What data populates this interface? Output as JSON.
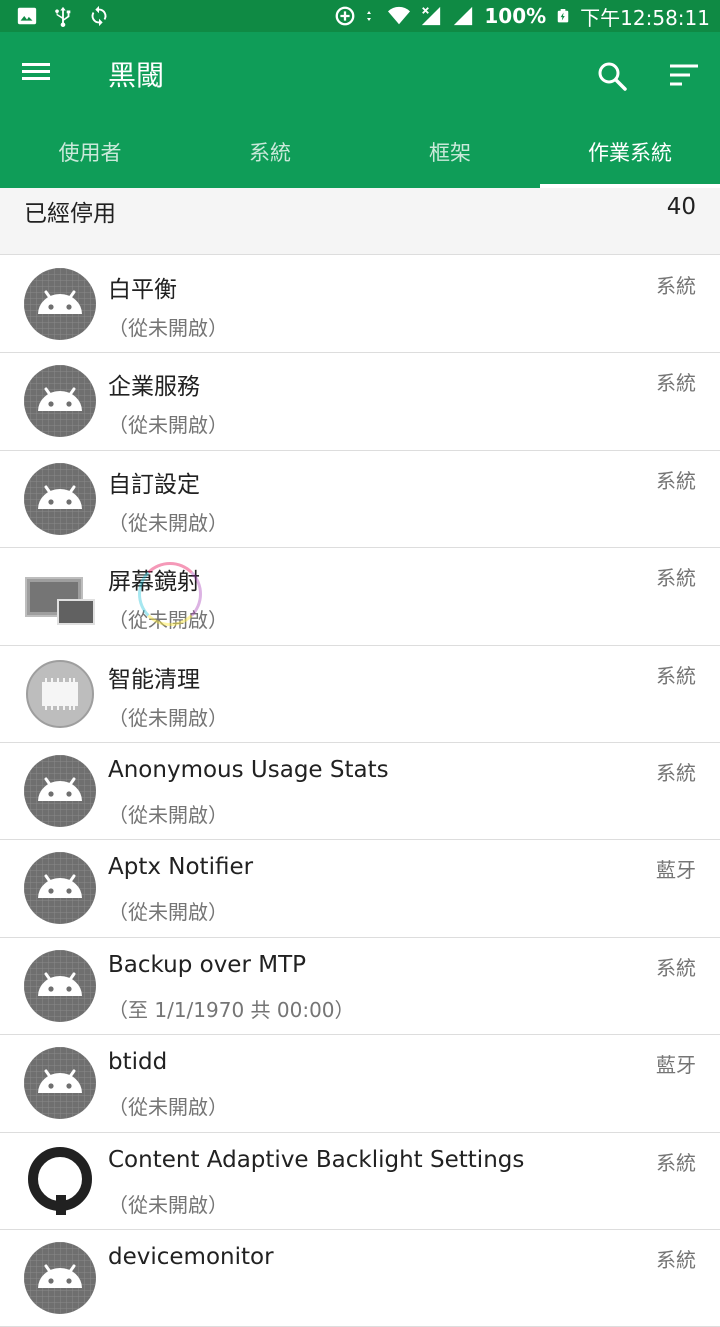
{
  "status_bar": {
    "battery": "100%",
    "time": "下午12:58:11",
    "left_icons": [
      "image-icon",
      "usb-icon",
      "sync-icon"
    ],
    "right_icons": [
      "data-saver-icon",
      "data-arrows-icon",
      "wifi-icon",
      "signal-no-sim-icon",
      "signal-icon",
      "battery-charging-icon"
    ]
  },
  "app_bar": {
    "title": "黑閾",
    "menu_icon": "menu-icon",
    "search_icon": "search-icon",
    "filter_icon": "sort-icon",
    "tabs": [
      {
        "label": "使用者",
        "active": false
      },
      {
        "label": "系統",
        "active": false
      },
      {
        "label": "框架",
        "active": false
      },
      {
        "label": "作業系統",
        "active": true
      }
    ]
  },
  "section": {
    "title": "已經停用",
    "count": "40"
  },
  "apps": [
    {
      "name": "白平衡",
      "status": "（從未開啟）",
      "category": "系統",
      "icon": "android-icon"
    },
    {
      "name": "企業服務",
      "status": "（從未開啟）",
      "category": "系統",
      "icon": "android-icon"
    },
    {
      "name": "自訂設定",
      "status": "（從未開啟）",
      "category": "系統",
      "icon": "android-icon"
    },
    {
      "name": "屏幕鏡射",
      "status": "（從未開啟）",
      "category": "系統",
      "icon": "screen-mirror-icon"
    },
    {
      "name": "智能清理",
      "status": "（從未開啟）",
      "category": "系統",
      "icon": "memory-chip-icon"
    },
    {
      "name": "Anonymous Usage Stats",
      "status": "（從未開啟）",
      "category": "系統",
      "icon": "android-icon"
    },
    {
      "name": "Aptx Notifier",
      "status": "（從未開啟）",
      "category": "藍牙",
      "icon": "android-icon"
    },
    {
      "name": "Backup over MTP",
      "status": "（至 1/1/1970 共 00:00）",
      "category": "系統",
      "icon": "android-icon"
    },
    {
      "name": "btidd",
      "status": "（從未開啟）",
      "category": "藍牙",
      "icon": "android-icon"
    },
    {
      "name": "Content Adaptive Backlight Settings",
      "status": "（從未開啟）",
      "category": "系統",
      "icon": "qualcomm-icon"
    },
    {
      "name": "devicemonitor",
      "status": "",
      "category": "系統",
      "icon": "android-icon"
    }
  ],
  "colors": {
    "status_bar": "#0f8a44",
    "app_bar": "#0f9d58",
    "android_icon_bg": "#6f6f6f"
  }
}
